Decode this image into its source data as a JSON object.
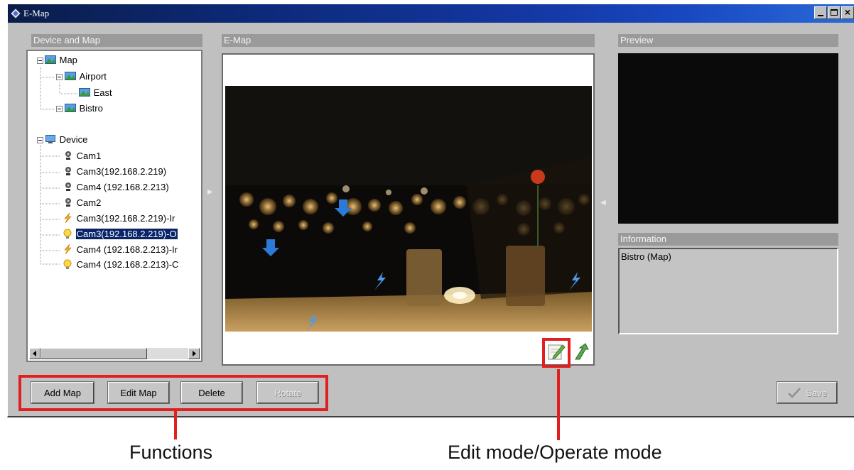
{
  "window": {
    "title": "E-Map",
    "colors": {
      "titlebar_start": "#0a1d4a",
      "titlebar_end": "#2a6ad8",
      "face": "#c0c0c0",
      "annotation": "#e02020"
    }
  },
  "device_panel": {
    "header": "Device and Map",
    "tree": {
      "map_root": "Map",
      "airport": "Airport",
      "east": "East",
      "bistro": "Bistro",
      "device_root": "Device",
      "cam1": "Cam1",
      "cam3": "Cam3(192.168.2.219)",
      "cam4": "Cam4 (192.168.2.213)",
      "cam2": "Cam2",
      "cam3_in": "Cam3(192.168.2.219)-Ir",
      "cam3_out": "Cam3(192.168.2.219)-O",
      "cam4_in": "Cam4 (192.168.2.213)-Ir",
      "cam4_out": "Cam4 (192.168.2.213)-C"
    }
  },
  "emap_panel": {
    "header": "E-Map"
  },
  "preview_panel": {
    "header": "Preview"
  },
  "info_panel": {
    "header": "Information",
    "text": "Bistro (Map)"
  },
  "buttons": {
    "add_map": "Add Map",
    "edit_map": "Edit Map",
    "delete": "Delete",
    "rotate": "Rotate",
    "save": "Save"
  },
  "annotations": {
    "functions": "Functions",
    "mode": "Edit mode/Operate mode"
  }
}
